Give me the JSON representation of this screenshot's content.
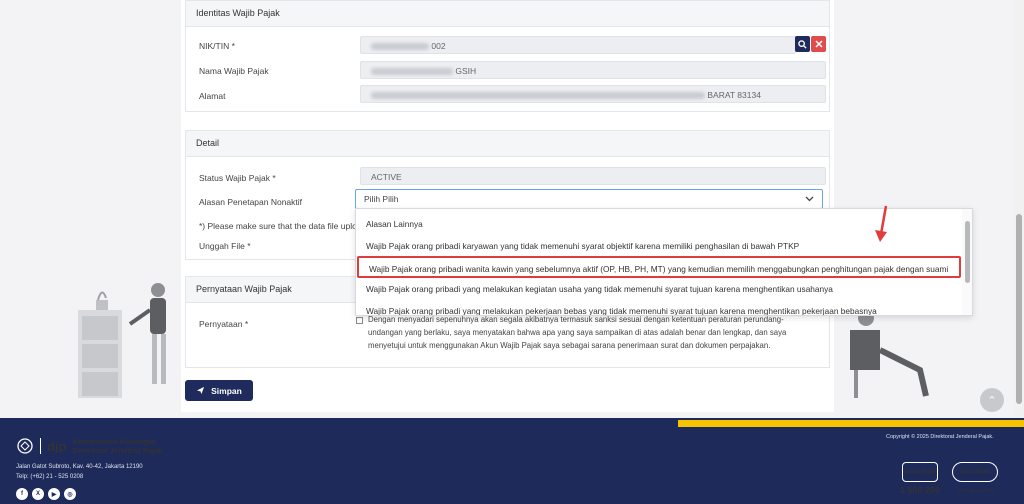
{
  "identitas": {
    "header": "Identitas Wajib Pajak",
    "nik_label": "NIK/TIN *",
    "nik_value": "002",
    "nama_label": "Nama Wajib Pajak",
    "nama_value": "GSIH",
    "alamat_label": "Alamat",
    "alamat_value": "BARAT 83134"
  },
  "detail": {
    "header": "Detail",
    "status_label": "Status Wajib Pajak *",
    "status_value": "ACTIVE",
    "alasan_label": "Alasan Penetapan Nonaktif",
    "alasan_value": "Pilih Pilih",
    "note": "*) Please make sure that the data file uploa",
    "unggah_label": "Unggah File *"
  },
  "dropdown": {
    "options": [
      "Alasan Lainnya",
      "Wajib Pajak orang pribadi karyawan yang tidak memenuhi syarat objektif karena memiliki penghasilan di bawah PTKP",
      "Wajib Pajak orang pribadi wanita kawin yang sebelumnya aktif (OP, HB, PH, MT) yang kemudian memilih menggabungkan penghitungan pajak dengan suami",
      "Wajib Pajak orang pribadi yang melakukan kegiatan usaha yang tidak memenuhi syarat tujuan karena menghentikan usahanya",
      "Wajib Pajak orang pribadi yang melakukan pekerjaan bebas yang tidak memenuhi syarat tujuan karena menghentikan pekerjaan bebasnya"
    ],
    "highlighted_index": 2
  },
  "pernyataan": {
    "header": "Pernyataan Wajib Pajak",
    "label": "Pernyataan *",
    "text_line1": "Dengan menyadari sepenuhnya akan segala akibatnya termasuk sanksi sesuai dengan ketentuan peraturan perundang-",
    "text_line2": "undangan yang berlaku, saya menyatakan bahwa apa yang saya sampaikan di atas adalah benar dan lengkap, dan saya",
    "text_line3": "menyetujui untuk menggunakan Akun Wajib Pajak saya sebagai sarana penerimaan surat dan dokumen perpajakan."
  },
  "actions": {
    "save_label": "Simpan"
  },
  "footer": {
    "brand": "djp",
    "ministry_line1": "Kementerian Keuangan",
    "ministry_line2": "Direktorat Jenderal Pajak",
    "address": "Jalan Gatot Subroto, Kav. 40-42, Jakarta 12190",
    "phone": "Telp: (+62) 21 - 525 0208",
    "copyright": "Copyright © 2025 Direktorat Jenderal Pajak.",
    "kring_label": "Kring Pajak",
    "kring_number": "1 500 200",
    "situs_label": "Situs Pajak",
    "situs_url": "www.pajak.go.id"
  },
  "colors": {
    "navy": "#1e2a5a",
    "yellow": "#f7c300",
    "highlight_red": "#e03c3c",
    "focus_blue": "#6aa6e8"
  }
}
